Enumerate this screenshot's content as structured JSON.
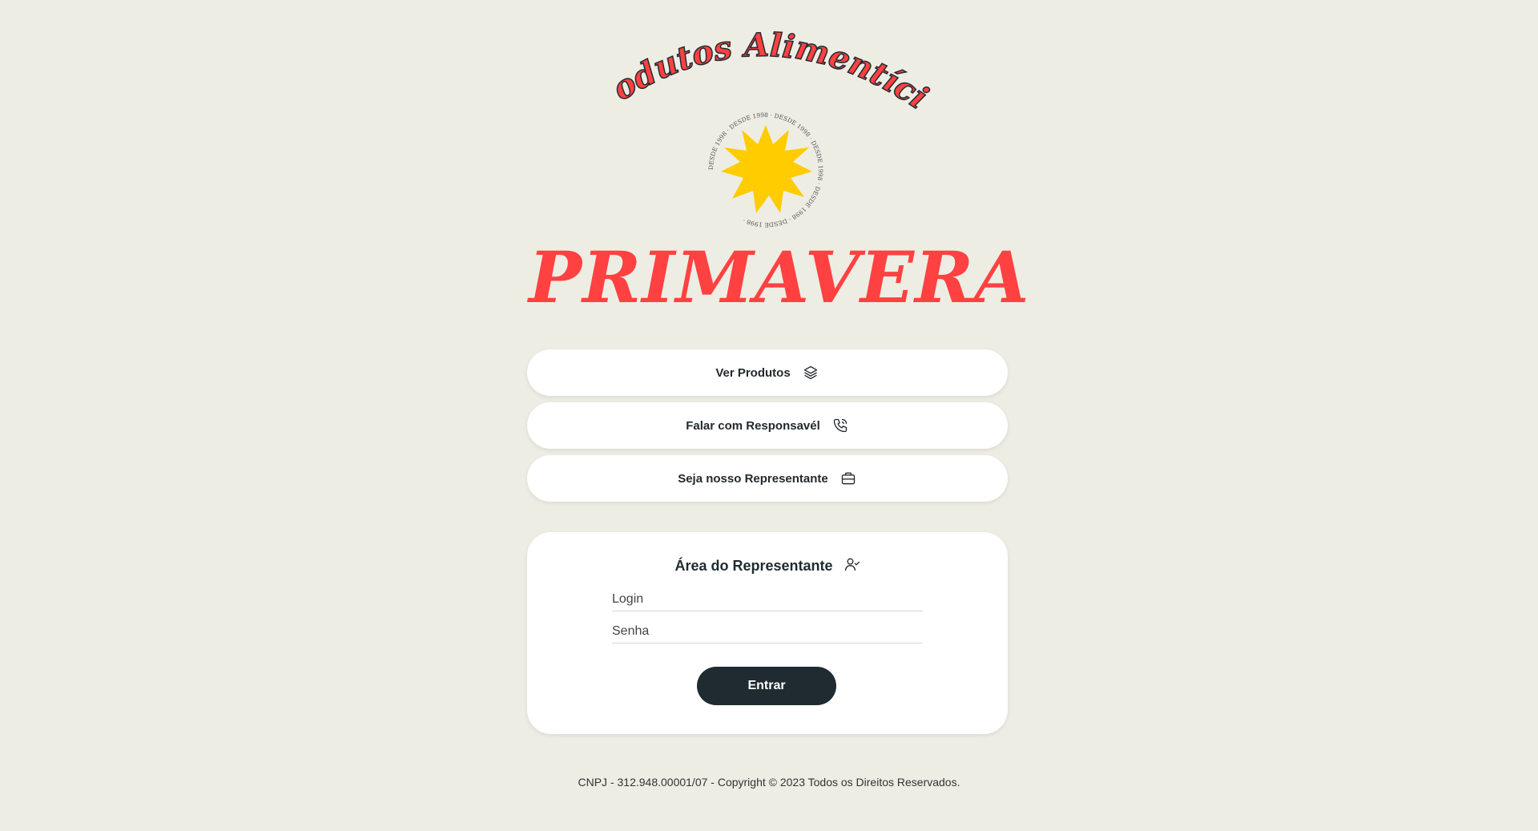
{
  "logo": {
    "arc_text": "Produtos Alimentícios",
    "seal_text": "DESDE 1998 · DESDE 1998 · DESDE 1998 · DESDE 1998 · DESDE 1998 · DESDE 1998 ·",
    "brand": "PRIMAVERA",
    "colors": {
      "red": "#ff4141",
      "sun": "#ffcc00",
      "outline": "#1f2b30"
    }
  },
  "actions": [
    {
      "label": "Ver Produtos",
      "icon": "layers-icon"
    },
    {
      "label": "Falar com Responsavél",
      "icon": "phone-icon"
    },
    {
      "label": "Seja nosso Representante",
      "icon": "briefcase-icon"
    }
  ],
  "login_card": {
    "title": "Área do Representante",
    "title_icon": "user-check-icon",
    "login_placeholder": "Login",
    "password_placeholder": "Senha",
    "submit_label": "Entrar"
  },
  "footer": {
    "text": "CNPJ - 312.948.00001/07 - Copyright © 2023 Todos os Direitos Reservados."
  },
  "theme": {
    "background": "#eeede4",
    "dark": "#1f2b30",
    "card": "#ffffff"
  }
}
